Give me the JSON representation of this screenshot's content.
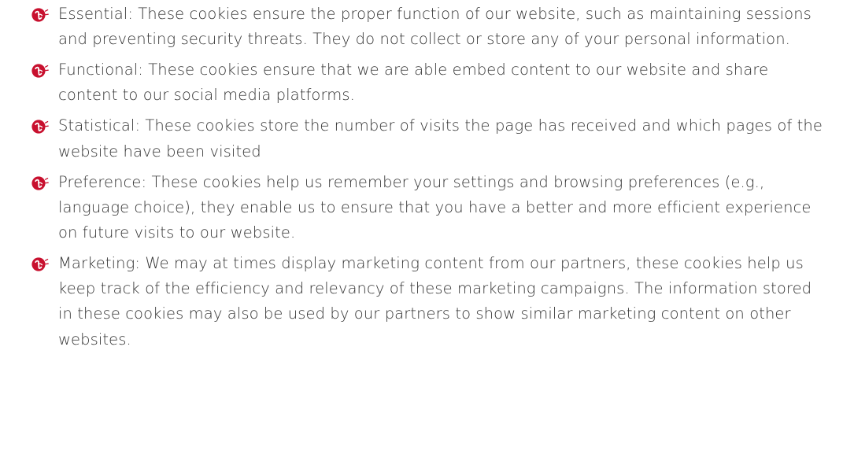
{
  "bullet_icon": "red-swirl-bullet-icon",
  "accent_color": "#c8102e",
  "cookie_types": [
    {
      "text": "Essential: These cookies ensure the proper function of our website, such as maintaining sessions and preventing security threats. They do not collect or store any of your personal information."
    },
    {
      "text": "Functional: These cookies ensure that we are able embed content to our website and share content to our social media platforms."
    },
    {
      "text": "Statistical: These cookies store the number of visits the page has received and which pages of the website have been visited"
    },
    {
      "text": "Preference: These cookies help us remember your settings and browsing preferences (e.g., language choice), they enable us to ensure that you have a better and more efficient experience on future visits to our website."
    },
    {
      "text": "Marketing: We may at times display marketing content from our partners, these cookies help us keep track of the efficiency and relevancy of these marketing campaigns. The information stored in these cookies may also be used by our partners to show similar marketing content on other websites."
    }
  ]
}
